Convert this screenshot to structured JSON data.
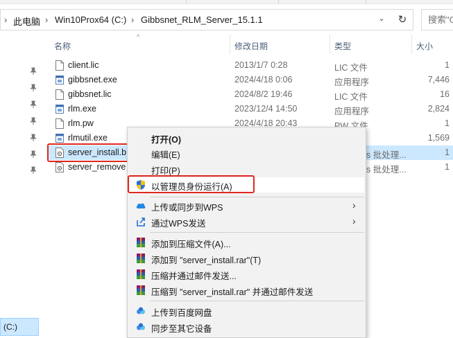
{
  "address": {
    "crumbs": [
      "此电脑",
      "Win10Prox64 (C:)",
      "Gibbsnet_RLM_Server_15.1.1"
    ],
    "separator": "›",
    "dropdown": "⌄",
    "refresh": "↻"
  },
  "search": {
    "placeholder": "搜索\"G"
  },
  "columns": {
    "name": "名称",
    "date": "修改日期",
    "type": "类型",
    "size": "大小"
  },
  "files": [
    {
      "name": "client.lic",
      "date": "2013/1/7 0:28",
      "type": "LIC 文件",
      "size": "1",
      "icon": "document-icon"
    },
    {
      "name": "gibbsnet.exe",
      "date": "2024/4/18 0:06",
      "type": "应用程序",
      "size": "7,446",
      "icon": "exe-icon"
    },
    {
      "name": "gibbsnet.lic",
      "date": "2024/8/2 19:46",
      "type": "LIC 文件",
      "size": "16",
      "icon": "document-icon"
    },
    {
      "name": "rlm.exe",
      "date": "2023/12/4 14:50",
      "type": "应用程序",
      "size": "2,824",
      "icon": "exe-icon"
    },
    {
      "name": "rlm.pw",
      "date": "2024/4/18 20:43",
      "type": "PW 文件",
      "size": "1",
      "icon": "document-icon"
    },
    {
      "name": "rlmutil.exe",
      "date": "",
      "type": "",
      "size": "1,569",
      "icon": "exe-icon"
    },
    {
      "name": "server_install.b",
      "date": "",
      "type": "ws 批处理...",
      "size": "1",
      "icon": "batch-icon"
    },
    {
      "name": "server_remove",
      "date": "",
      "type": "ws 批处理...",
      "size": "1",
      "icon": "batch-icon"
    }
  ],
  "nav": {
    "drive_label": "(C:)"
  },
  "context_menu": {
    "open": "打开(O)",
    "edit": "编辑(E)",
    "print": "打印(P)",
    "run_as_admin": "以管理员身份运行(A)",
    "upload_wps": "上传或同步到WPS",
    "send_wps": "通过WPS发送",
    "add_archive": "添加到压缩文件(A)...",
    "add_rar": "添加到 \"server_install.rar\"(T)",
    "compress_email": "压缩并通过邮件发送...",
    "compress_rar_email": "压缩到 \"server_install.rar\" 并通过邮件发送",
    "upload_baidu": "上传到百度网盘",
    "sync_devices": "同步至其它设备",
    "submenu_arrow": "›"
  },
  "colors": {
    "selection": "#cce8ff",
    "highlight": "#e0271f",
    "menu_bg": "#f2f2f2"
  }
}
